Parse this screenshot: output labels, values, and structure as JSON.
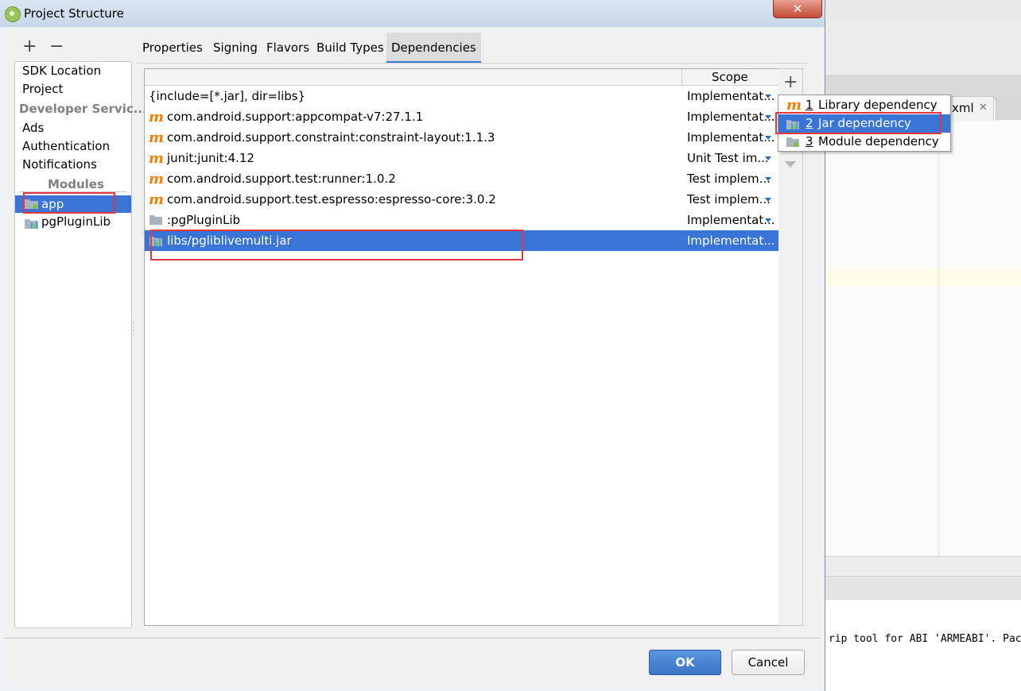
{
  "dialog": {
    "title": "Project Structure",
    "close_label": "✕"
  },
  "background": {
    "editor_tab": "xml",
    "editor_tab_close": "✕",
    "console_line": "rip tool for ABI 'ARMEABI'. Pac"
  },
  "nav": {
    "add": "+",
    "remove": "−",
    "sdk_location": "SDK Location",
    "project": "Project",
    "developer_services": "Developer Servic...",
    "ads": "Ads",
    "authentication": "Authentication",
    "notifications": "Notifications",
    "modules_label": "Modules",
    "modules": [
      {
        "label": "app",
        "selected": true
      },
      {
        "label": "pgPluginLib",
        "selected": false
      }
    ]
  },
  "tabs": [
    {
      "label": "Properties"
    },
    {
      "label": "Signing"
    },
    {
      "label": "Flavors"
    },
    {
      "label": "Build Types"
    },
    {
      "label": "Dependencies",
      "active": true
    }
  ],
  "table": {
    "scope_header": "Scope",
    "rows": [
      {
        "icon": "none",
        "name": "{include=[*.jar], dir=libs}",
        "scope": "Implementat..."
      },
      {
        "icon": "maven-icon",
        "name": "com.android.support:appcompat-v7:27.1.1",
        "scope": "Implementat..."
      },
      {
        "icon": "maven-icon",
        "name": "com.android.support.constraint:constraint-layout:1.1.3",
        "scope": "Implementat..."
      },
      {
        "icon": "maven-icon",
        "name": "junit:junit:4.12",
        "scope": "Unit Test im..."
      },
      {
        "icon": "maven-icon",
        "name": "com.android.support.test:runner:1.0.2",
        "scope": "Test implem..."
      },
      {
        "icon": "maven-icon",
        "name": "com.android.support.test.espresso:espresso-core:3.0.2",
        "scope": "Test implem..."
      },
      {
        "icon": "folder-icon",
        "name": ":pgPluginLib",
        "scope": "Implementat..."
      },
      {
        "icon": "jar-icon",
        "name": "libs/pgliblivemulti.jar",
        "scope": "Implementat...",
        "selected": true
      }
    ]
  },
  "side_toolbar": {
    "add": "+"
  },
  "popup": {
    "items": [
      {
        "num": "1",
        "label": "Library dependency",
        "icon": "maven-icon"
      },
      {
        "num": "2",
        "label": "Jar dependency",
        "icon": "jar-icon",
        "selected": true
      },
      {
        "num": "3",
        "label": "Module dependency",
        "icon": "module-folder-icon"
      }
    ]
  },
  "buttons": {
    "ok": "OK",
    "cancel": "Cancel"
  },
  "colors": {
    "selection": "#3875d7",
    "maven_icon": "#f57d00",
    "highlight_box": "#e8373a"
  }
}
